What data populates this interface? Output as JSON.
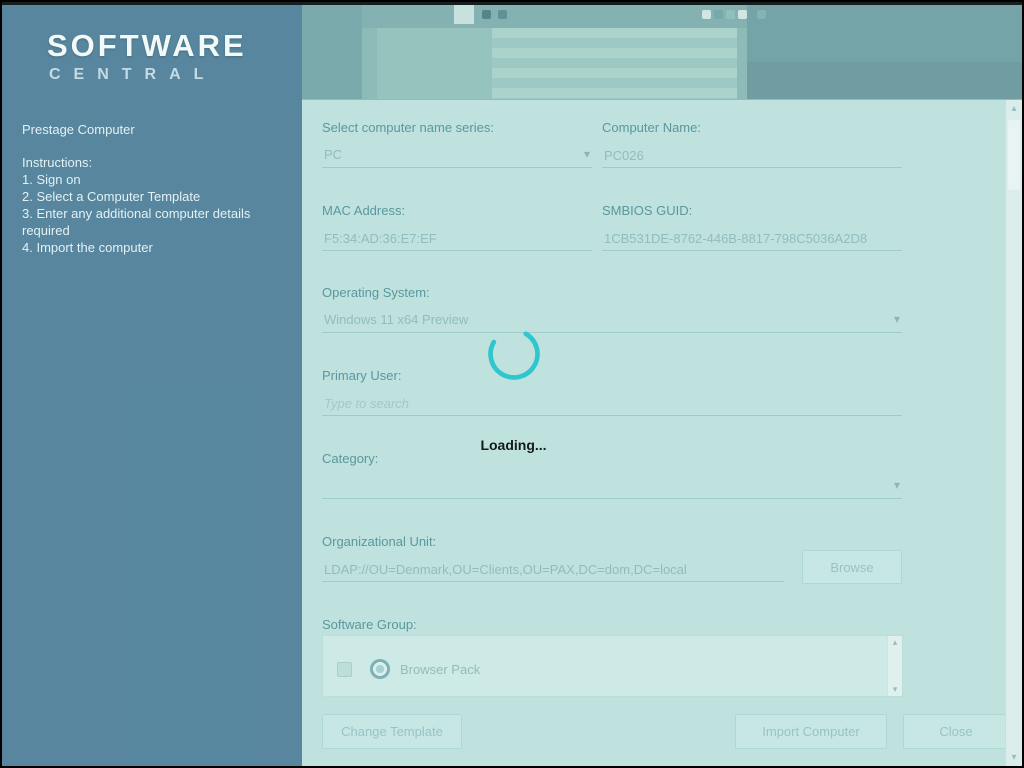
{
  "logo": {
    "line1": "SOFTWARE",
    "line2": "CENTRAL"
  },
  "sidebar": {
    "title": "Prestage Computer",
    "instructions_heading": "Instructions:",
    "steps": [
      "1. Sign on",
      "2. Select a Computer Template",
      "3. Enter any additional computer details required",
      "4. Import the computer"
    ]
  },
  "form": {
    "name_series_label": "Select computer name series:",
    "name_series_value": "PC",
    "computer_name_label": "Computer Name:",
    "computer_name_value": "PC026",
    "mac_label": "MAC Address:",
    "mac_value": "F5:34:AD:36:E7:EF",
    "smbios_label": "SMBIOS GUID:",
    "smbios_value": "1CB531DE-8762-446B-8817-798C5036A2D8",
    "os_label": "Operating System:",
    "os_value": "Windows 11 x64 Preview",
    "primary_user_label": "Primary User:",
    "primary_user_placeholder": "Type to search",
    "category_label": "Category:",
    "category_value": "",
    "ou_label": "Organizational Unit:",
    "ou_value": "LDAP://OU=Denmark,OU=Clients,OU=PAX,DC=dom,DC=local",
    "browse_button": "Browse",
    "software_group_label": "Software Group:",
    "software_items": [
      {
        "label": "Browser Pack",
        "checked": false,
        "icon": "chrome-icon"
      }
    ]
  },
  "footer": {
    "change_template": "Change Template",
    "import_computer": "Import Computer",
    "close": "Close"
  },
  "loading": {
    "text": "Loading..."
  },
  "icons": {
    "dropdown_chevron": "▾",
    "scroll_up_arrow": "▴",
    "scroll_down_arrow": "▾"
  },
  "colors": {
    "sidebar": "#4b7a95",
    "form_background": "#c4e5e1",
    "accent_spinner": "#2fc6ce",
    "label_text": "#4f8d95",
    "value_text": "#8fb8ba"
  }
}
